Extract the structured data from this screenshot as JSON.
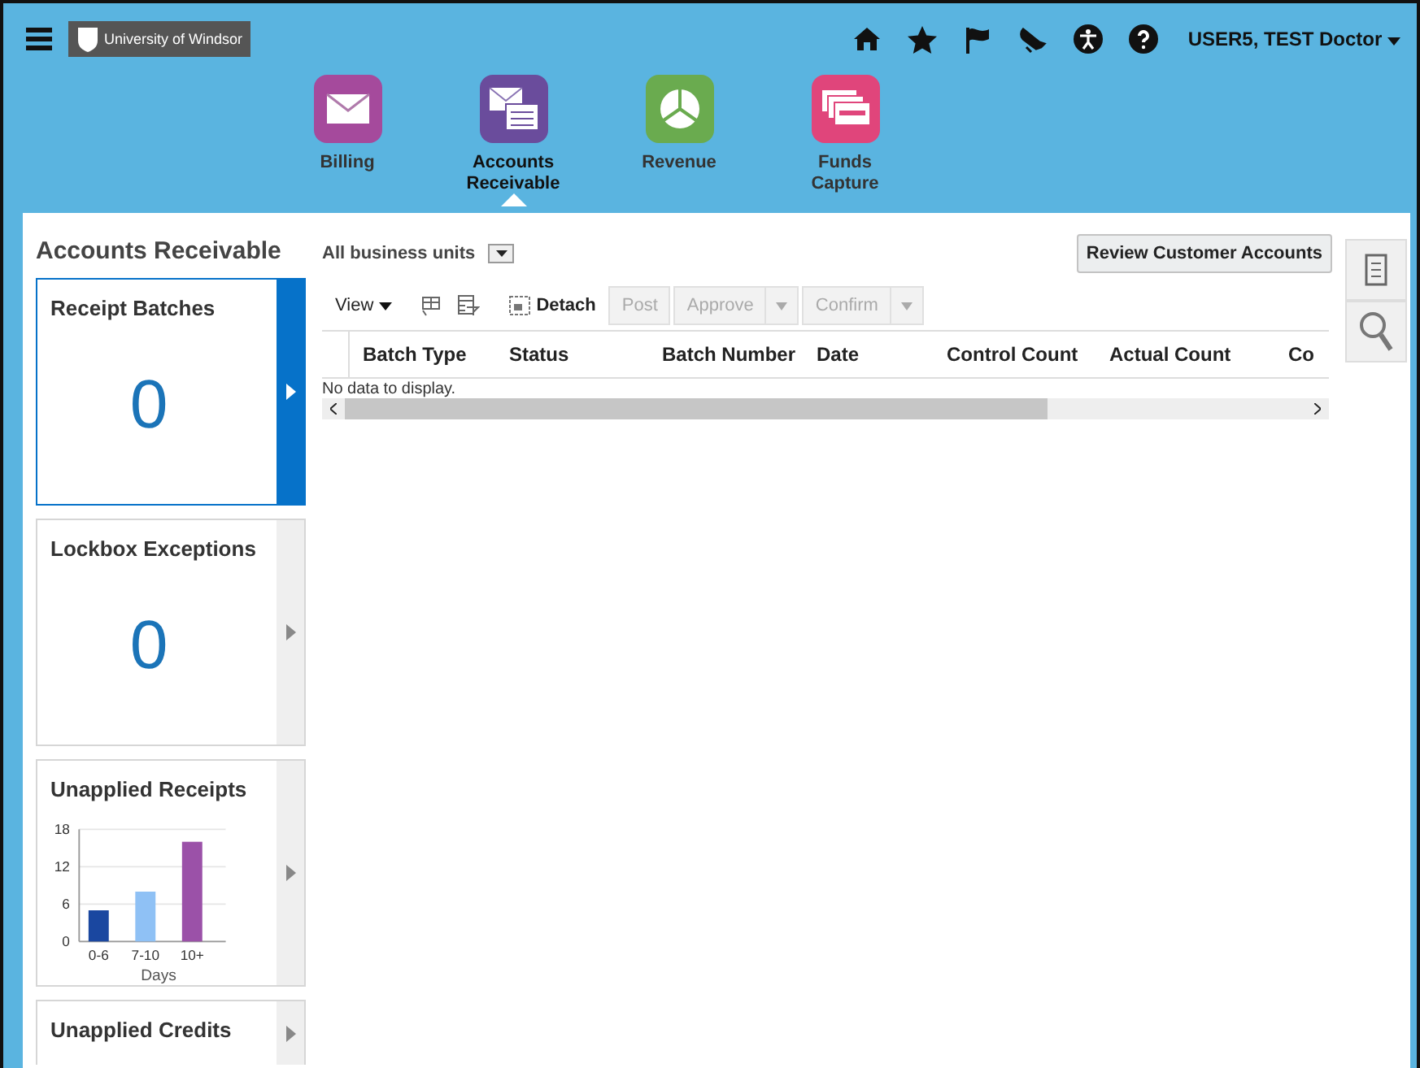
{
  "header": {
    "logo": "University of Windsor",
    "user": "USER5, TEST Doctor"
  },
  "apps": [
    {
      "label": "Billing",
      "color": "#a54a9c",
      "kind": "envelope",
      "selected": false
    },
    {
      "label": "Accounts Receivable",
      "color": "#6a4c9c",
      "kind": "letter",
      "selected": true
    },
    {
      "label": "Revenue",
      "color": "#6aab4f",
      "kind": "pie",
      "selected": false
    },
    {
      "label": "Funds Capture",
      "color": "#e0457b",
      "kind": "cards",
      "selected": false
    }
  ],
  "page_title": "Accounts Receivable",
  "business_unit": "All business units",
  "review_button": "Review Customer Accounts",
  "tiles": [
    {
      "title": "Receipt Batches",
      "kind": "count",
      "value": "0",
      "selected": true
    },
    {
      "title": "Lockbox Exceptions",
      "kind": "count",
      "value": "0",
      "selected": false
    },
    {
      "title": "Unapplied Receipts",
      "kind": "chart",
      "selected": false,
      "chart_data": {
        "type": "bar",
        "xlabel": "Days",
        "categories": [
          "0-6",
          "7-10",
          "10+"
        ],
        "values": [
          5,
          8,
          16
        ],
        "colors": [
          "#1a47a0",
          "#8fc1f5",
          "#9b51a8"
        ],
        "ylim": [
          0,
          18
        ],
        "yticks": [
          0,
          6,
          12,
          18
        ]
      }
    },
    {
      "title": "Unapplied Credits",
      "kind": "count",
      "selected": false
    }
  ],
  "toolbar": {
    "view": "View",
    "detach": "Detach",
    "post": "Post",
    "approve": "Approve",
    "confirm": "Confirm"
  },
  "table": {
    "columns": [
      "Batch Type",
      "Status",
      "Batch Number",
      "Date",
      "Control Count",
      "Actual Count",
      "Co"
    ],
    "empty": "No data to display."
  }
}
